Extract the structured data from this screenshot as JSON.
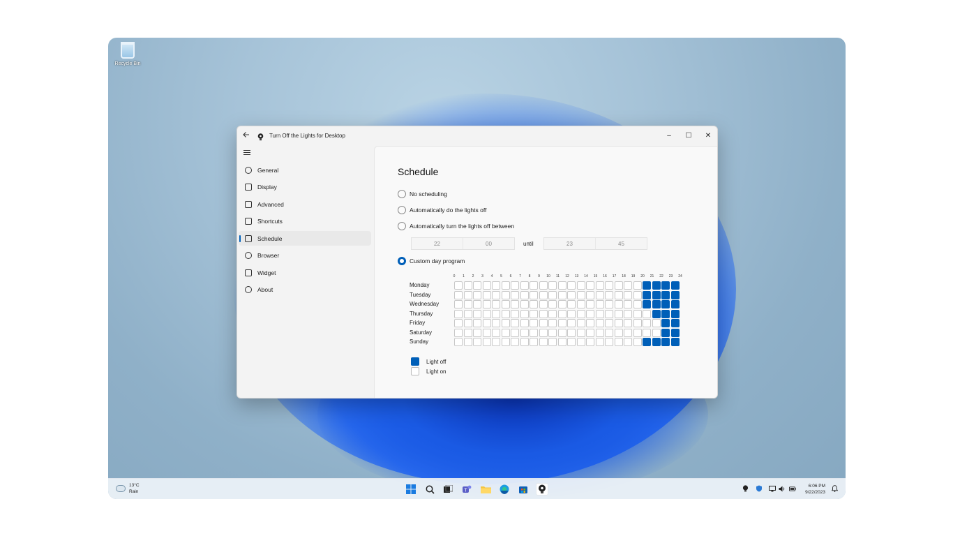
{
  "desktop": {
    "recycle_bin": "Recycle Bin"
  },
  "window": {
    "title": "Turn Off the Lights for Desktop",
    "controls": {
      "minimize": "–",
      "maximize": "☐",
      "close": "✕"
    }
  },
  "sidebar": {
    "items": [
      {
        "label": "General",
        "icon": "palette-icon",
        "selected": false
      },
      {
        "label": "Display",
        "icon": "display-icon",
        "selected": false
      },
      {
        "label": "Advanced",
        "icon": "advanced-icon",
        "selected": false
      },
      {
        "label": "Shortcuts",
        "icon": "keyboard-icon",
        "selected": false
      },
      {
        "label": "Schedule",
        "icon": "calendar-icon",
        "selected": true
      },
      {
        "label": "Browser",
        "icon": "globe-icon",
        "selected": false
      },
      {
        "label": "Widget",
        "icon": "widget-icon",
        "selected": false
      },
      {
        "label": "About",
        "icon": "info-icon",
        "selected": false
      }
    ]
  },
  "schedule": {
    "title": "Schedule",
    "options": [
      {
        "label": "No scheduling",
        "checked": false
      },
      {
        "label": "Automatically do the lights off",
        "checked": false
      },
      {
        "label": "Automatically turn the lights off between",
        "checked": false
      },
      {
        "label": "Custom day program",
        "checked": true
      }
    ],
    "between": {
      "start_hour": "22",
      "start_minute": "00",
      "until": "until",
      "end_hour": "23",
      "end_minute": "45"
    },
    "hours": [
      "0",
      "1",
      "2",
      "3",
      "4",
      "5",
      "6",
      "7",
      "8",
      "9",
      "10",
      "11",
      "12",
      "13",
      "14",
      "15",
      "16",
      "17",
      "18",
      "19",
      "20",
      "21",
      "22",
      "23",
      "24"
    ],
    "days": [
      {
        "name": "Monday",
        "off_hours": [
          20,
          21,
          22,
          23
        ]
      },
      {
        "name": "Tuesday",
        "off_hours": [
          20,
          21,
          22,
          23
        ]
      },
      {
        "name": "Wednesday",
        "off_hours": [
          20,
          21,
          22,
          23
        ]
      },
      {
        "name": "Thursday",
        "off_hours": [
          21,
          22,
          23
        ]
      },
      {
        "name": "Friday",
        "off_hours": [
          22,
          23
        ]
      },
      {
        "name": "Saturday",
        "off_hours": [
          22,
          23
        ]
      },
      {
        "name": "Sunday",
        "off_hours": [
          20,
          21,
          22,
          23
        ]
      }
    ],
    "legend": {
      "off": "Light off",
      "on": "Light on"
    },
    "colors": {
      "accent": "#005fb8"
    }
  },
  "taskbar": {
    "weather": {
      "temp": "13°C",
      "condition": "Rain"
    },
    "clock": {
      "time": "6:06 PM",
      "date": "9/22/2023"
    }
  }
}
